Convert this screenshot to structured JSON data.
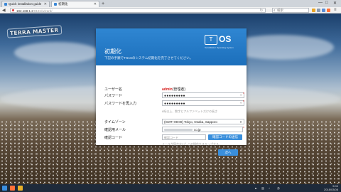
{
  "browser": {
    "tabs": [
      {
        "label": "Quick installation guide",
        "active": false
      },
      {
        "label": "初期化",
        "active": true
      }
    ],
    "new_tab": "+",
    "url_host": "192.168.1.2",
    "url_path": ":8181/wizard/",
    "search_placeholder": "検索",
    "window_controls": [
      "—",
      "□",
      "✕"
    ]
  },
  "page": {
    "logo": "TERRA MASTER"
  },
  "dialog": {
    "title": "初期化",
    "subtitle": "下記の手順でTNASのシステム初期化を完了させてください。",
    "brand_box": "T",
    "brand_text": "OS",
    "brand_tagline": "TerraMaster Operating System",
    "fields": {
      "username_label": "ユーザー名",
      "username_value": "admin",
      "username_note": "(管理者)",
      "password_label": "パスワード",
      "password_value": "●●●●●●●●●",
      "password_confirm_label": "パスワードを再入力",
      "password_confirm_value": "●●●●●●●●●",
      "password_hint": "8桁以上、数字とアルファベットだけの長さ",
      "timezone_label": "タイムゾーン",
      "timezone_value": "(GMT+09:00) Tokyo, Osaka, Sapporo",
      "email_label": "確認用メール",
      "email_value": "co.jp",
      "code_label": "確認コード",
      "code_placeholder": "確認コード",
      "send_code_button": "確認コードの送信",
      "skip_link": "メールが届かない？この操作をスキップする。",
      "next_button": "次へ",
      "required_mark": "*"
    }
  },
  "taskbar": {
    "clock_time": "5:04",
    "clock_date": "2018/03/08",
    "language": "あ"
  },
  "colors": {
    "header_blue": "#2f86d2",
    "accent_red": "#d6201f",
    "button_blue": "#3a8fdc"
  }
}
